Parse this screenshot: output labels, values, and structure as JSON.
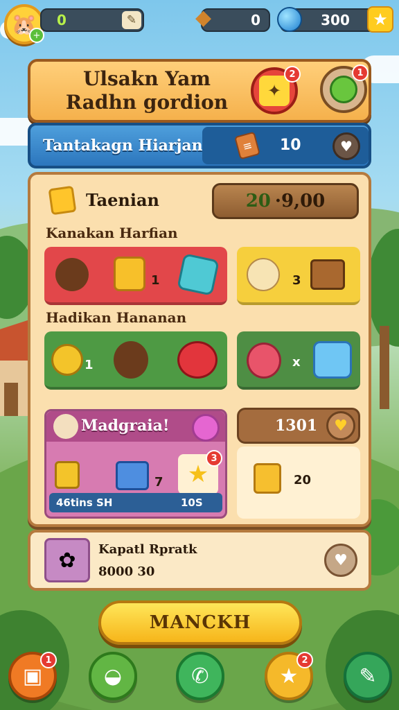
{
  "hud": {
    "xp_value": "0",
    "gift_count": "0",
    "gem_count": "300",
    "avatar_badge": "+"
  },
  "title_banner": {
    "title_line1": "Ulsakn Yam",
    "title_line2": "Radhn gordion",
    "red_button_badge": "2",
    "green_button_badge": "1"
  },
  "blue_banner": {
    "title": "Tantakagn Hiarjan",
    "count": "10"
  },
  "panel": {
    "title": "Taenian",
    "score_a": "20",
    "score_b": "·9,00",
    "section1_label": "Kanakan Harfian",
    "section2_label": "Hadikan Hananan",
    "red_row_qty": "1",
    "yellow_row_qty": "3",
    "green_row_qty": "1",
    "green_row2_qty": "x",
    "promo_title": "Madgraia!",
    "promo_qty": "7",
    "promo_star_badge": "3",
    "promo_bar_left": "46tins SH",
    "promo_bar_right": "10S",
    "side_value": "1301",
    "side_scroll_qty": "20"
  },
  "info_card": {
    "title": "Kapatl Rpratk",
    "subtitle": "8000 30"
  },
  "main_button": {
    "label": "MANCKH"
  },
  "nav": {
    "badge_1": "1",
    "badge_4": "2"
  }
}
